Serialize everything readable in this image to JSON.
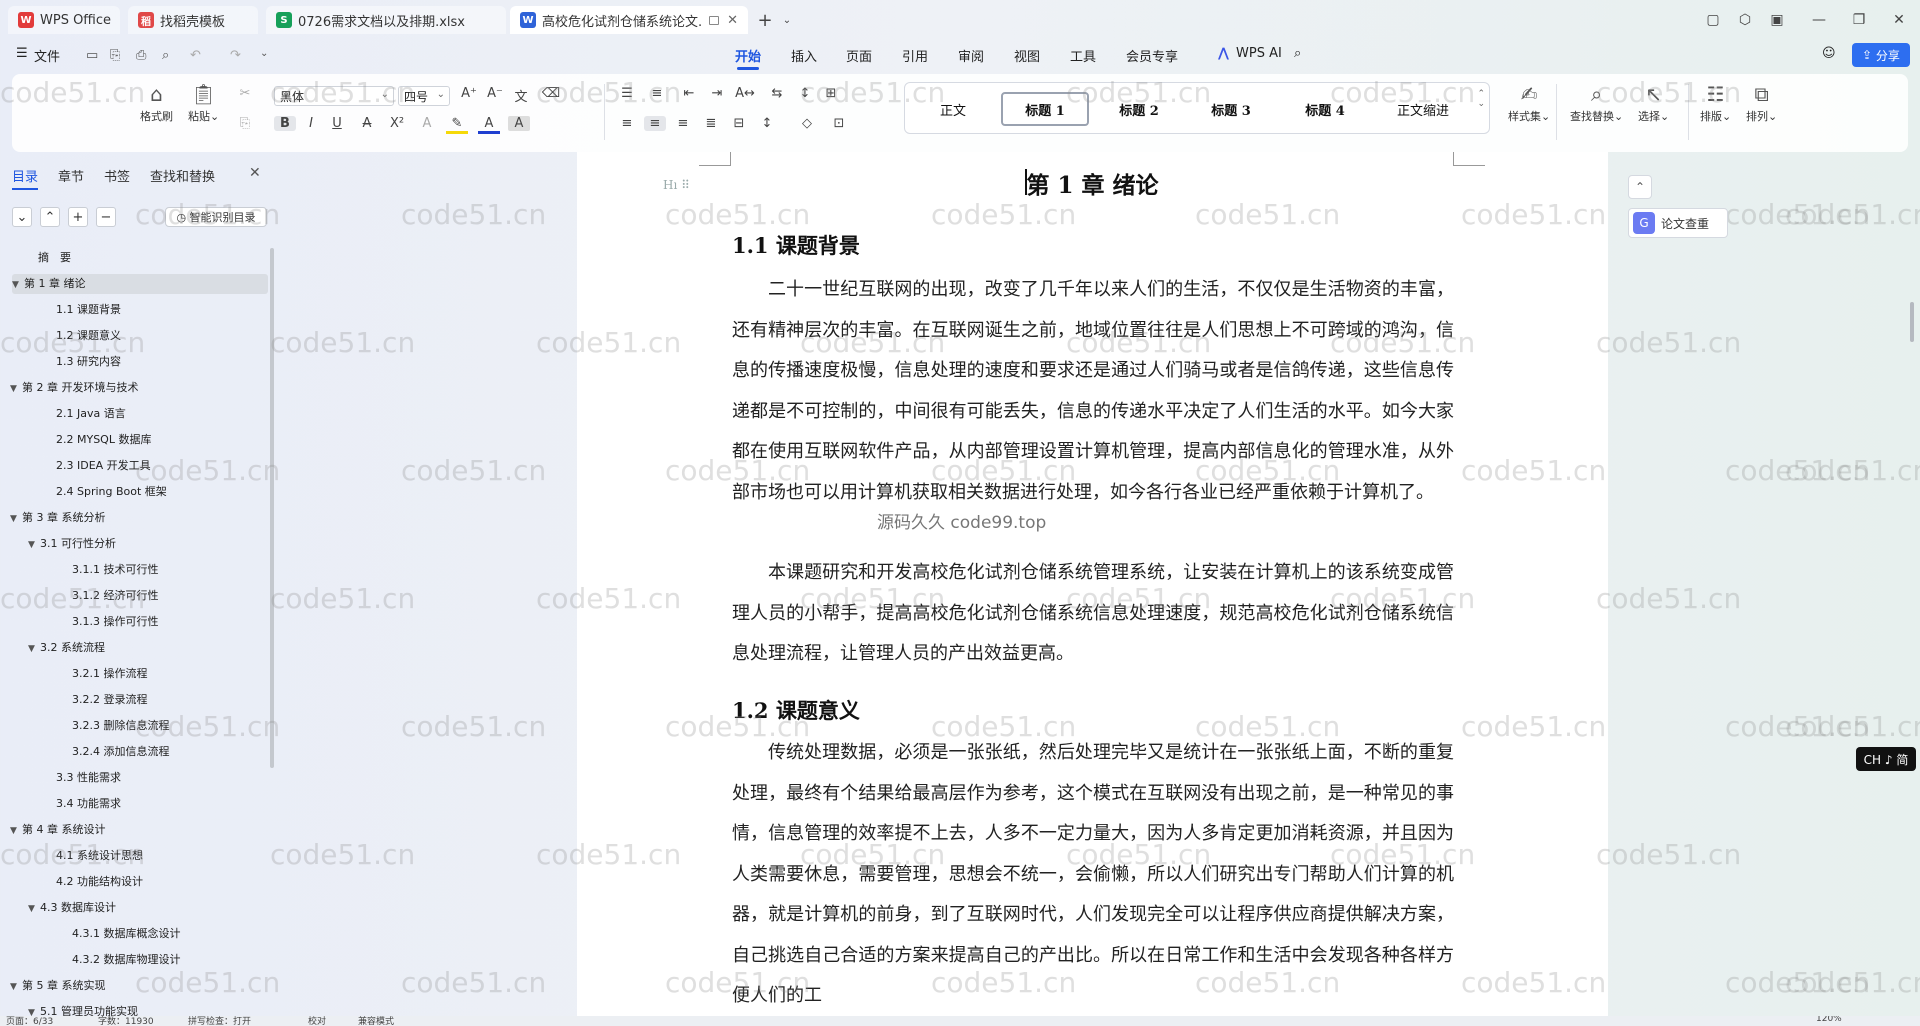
{
  "tabs": [
    {
      "label": "WPS Office",
      "icon": "wps-logo-icon",
      "color": "#e23b3b"
    },
    {
      "label": "找稻壳模板",
      "icon": "docer-icon",
      "color": "#e04848"
    },
    {
      "label": "0726需求文档以及排期.xlsx",
      "icon": "spreadsheet-icon",
      "color": "#16a05a"
    },
    {
      "label": "高校危化试剂仓储系统论文.docx",
      "icon": "writer-icon",
      "color": "#2f63d8"
    }
  ],
  "menu": {
    "file": "文件",
    "items": [
      "开始",
      "插入",
      "页面",
      "引用",
      "审阅",
      "视图",
      "工具",
      "会员专享"
    ],
    "active": "开始",
    "wps_ai": "WPS AI",
    "share": "分享"
  },
  "ribbon": {
    "format_painter": "格式刷",
    "paste": "粘贴",
    "font_name": "黑体",
    "font_size": "四号",
    "styles": [
      "正文",
      "标题 1",
      "标题 2",
      "标题 3",
      "标题 4",
      "正文缩进"
    ],
    "style_set": "样式集",
    "find_replace": "查找替换",
    "select": "选择",
    "layout": "排版",
    "arrange": "排列"
  },
  "nav": {
    "tabs": [
      "目录",
      "章节",
      "书签",
      "查找和替换"
    ],
    "smart_toc": "智能识别目录",
    "toc": [
      {
        "label": "摘　要",
        "level": 1,
        "caret": ""
      },
      {
        "label": "第 1 章  绪论",
        "level": 1,
        "caret": "▼"
      },
      {
        "label": "1.1  课题背景",
        "level": 2,
        "caret": ""
      },
      {
        "label": "1.2  课题意义",
        "level": 2,
        "caret": ""
      },
      {
        "label": "1.3  研究内容",
        "level": 2,
        "caret": ""
      },
      {
        "label": "第 2 章  开发环境与技术",
        "level": 1,
        "caret": "▼"
      },
      {
        "label": "2.1 Java 语言",
        "level": 2,
        "caret": ""
      },
      {
        "label": "2.2 MYSQL 数据库",
        "level": 2,
        "caret": ""
      },
      {
        "label": "2.3 IDEA 开发工具",
        "level": 2,
        "caret": ""
      },
      {
        "label": "2.4 Spring Boot 框架",
        "level": 2,
        "caret": ""
      },
      {
        "label": "第 3 章  系统分析",
        "level": 1,
        "caret": "▼"
      },
      {
        "label": "3.1  可行性分析",
        "level": 2,
        "caret": "▼"
      },
      {
        "label": "3.1.1  技术可行性",
        "level": 3,
        "caret": ""
      },
      {
        "label": "3.1.2  经济可行性",
        "level": 3,
        "caret": ""
      },
      {
        "label": "3.1.3  操作可行性",
        "level": 3,
        "caret": ""
      },
      {
        "label": "3.2  系统流程",
        "level": 2,
        "caret": "▼"
      },
      {
        "label": "3.2.1  操作流程",
        "level": 3,
        "caret": ""
      },
      {
        "label": "3.2.2  登录流程",
        "level": 3,
        "caret": ""
      },
      {
        "label": "3.2.3  删除信息流程",
        "level": 3,
        "caret": ""
      },
      {
        "label": "3.2.4  添加信息流程",
        "level": 3,
        "caret": ""
      },
      {
        "label": "3.3  性能需求",
        "level": 2,
        "caret": ""
      },
      {
        "label": "3.4  功能需求",
        "level": 2,
        "caret": ""
      },
      {
        "label": "第 4 章  系统设计",
        "level": 1,
        "caret": "▼"
      },
      {
        "label": "4.1  系统设计思想",
        "level": 2,
        "caret": ""
      },
      {
        "label": "4.2  功能结构设计",
        "level": 2,
        "caret": ""
      },
      {
        "label": "4.3  数据库设计",
        "level": 2,
        "caret": "▼"
      },
      {
        "label": "4.3.1  数据库概念设计",
        "level": 3,
        "caret": ""
      },
      {
        "label": "4.3.2  数据库物理设计",
        "level": 3,
        "caret": ""
      },
      {
        "label": "第 5 章  系统实现",
        "level": 1,
        "caret": "▼"
      },
      {
        "label": "5.1  管理员功能实现",
        "level": 2,
        "caret": "▼"
      }
    ],
    "selected_index": 1
  },
  "doc": {
    "chapter_title": "第 1 章  绪论",
    "section1_title": "1.1  课题背景",
    "section1_p1": "二十一世纪互联网的出现，改变了几千年以来人们的生活，不仅仅是生活物资的丰富，还有精神层次的丰富。在互联网诞生之前，地域位置往往是人们思想上不可跨域的鸿沟，信息的传播速度极慢，信息处理的速度和要求还是通过人们骑马或者是信鸽传递，这些信息传递都是不可控制的，中间很有可能丢失，信息的传递水平决定了人们生活的水平。如今大家都在使用互联网软件产品，从内部管理设置计算机管理，提高内部信息化的管理水准，从外部市场也可以用计算机获取相关数据进行处理，如今各行各业已经严重依赖于计算机了。",
    "section1_p2": "本课题研究和开发高校危化试剂仓储系统管理系统，让安装在计算机上的该系统变成管理人员的小帮手，提高高校危化试剂仓储系统信息处理速度，规范高校危化试剂仓储系统信息处理流程，让管理人员的产出效益更高。",
    "section2_title": "1.2  课题意义",
    "section2_p1": "传统处理数据，必须是一张张纸，然后处理完毕又是统计在一张张纸上面，不断的重复处理，最终有个结果给最高层作为参考，这个模式在互联网没有出现之前，是一种常见的事情，信息管理的效率提不上去，人多不一定力量大，因为人多肯定更加消耗资源，并且因为人类需要休息，需要管理，思想会不统一，会偷懒，所以人们研究出专门帮助人们计算的机器，就是计算机的前身，到了互联网时代，人们发现完全可以让程序供应商提供解决方案，自己挑选自己合适的方案来提高自己的产出比。所以在日常工作和生活中会发现各种各样方便人们的工"
  },
  "overlays": {
    "watermark": "code51.cn",
    "center_watermark": "源码久久 code99.top",
    "plagiarism": "论文查重",
    "ime": "CH ♪ 简"
  },
  "status": {
    "page": "页面：6/33",
    "words": "字数：11930",
    "spell": "拼写检查：打开",
    "proof": "校对",
    "compat": "兼容模式",
    "zoom": "120%"
  }
}
